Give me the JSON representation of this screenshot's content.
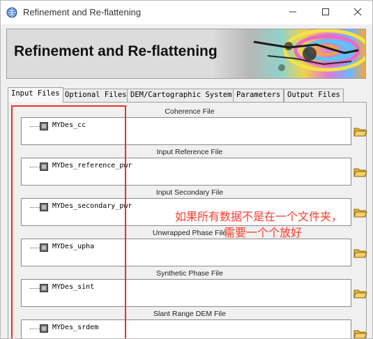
{
  "window": {
    "title": "Refinement and Re-flattening",
    "controls": [
      "minimize-icon",
      "maximize-icon",
      "close-icon"
    ]
  },
  "banner": {
    "title": "Refinement and Re-flattening"
  },
  "tabs": [
    {
      "label": "Input Files",
      "active": true
    },
    {
      "label": "Optional Files",
      "active": false
    },
    {
      "label": "DEM/Cartographic System",
      "active": false
    },
    {
      "label": "Parameters",
      "active": false
    },
    {
      "label": "Output Files",
      "active": false
    }
  ],
  "files": [
    {
      "label": "Coherence File",
      "value": "MYDes_cc"
    },
    {
      "label": "Input Reference File",
      "value": "MYDes_reference_pwr"
    },
    {
      "label": "Input Secondary File",
      "value": "MYDes_secondary_pwr"
    },
    {
      "label": "Unwrapped Phase File",
      "value": "MYDes_upha"
    },
    {
      "label": "Synthetic Phase File",
      "value": "MYDes_sint"
    },
    {
      "label": "Slant Range DEM File",
      "value": "MYDes_srdem"
    }
  ],
  "annotation": {
    "text_line1": "如果所有数据不是在一个文件夹，",
    "text_line2": "需要一个个放好",
    "color": "#ff3a2a"
  },
  "icons": {
    "app": "app-globe-icon",
    "folder": "folder-open-icon",
    "file": "raster-file-icon"
  }
}
